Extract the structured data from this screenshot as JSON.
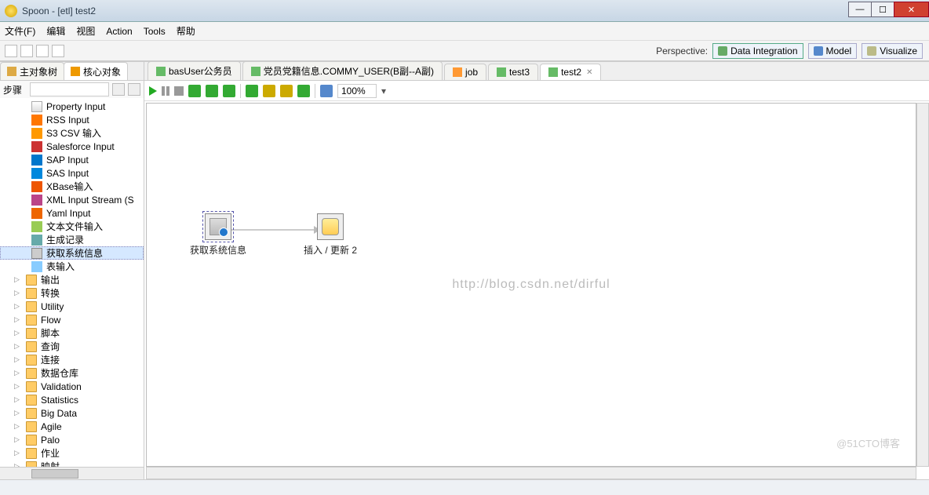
{
  "window": {
    "title": "Spoon - [etl] test2"
  },
  "menu": {
    "file": "文件(F)",
    "edit": "编辑",
    "view": "视图",
    "action": "Action",
    "tools": "Tools",
    "help": "帮助"
  },
  "perspective": {
    "label": "Perspective:",
    "data_integration": "Data Integration",
    "model": "Model",
    "visualize": "Visualize"
  },
  "left": {
    "tab_main": "主对象树",
    "tab_core": "核心对象",
    "steps_label": "步骤",
    "tree_leaf": [
      {
        "label": "Property Input",
        "cls": "file"
      },
      {
        "label": "RSS Input",
        "cls": "rss"
      },
      {
        "label": "S3 CSV 输入",
        "cls": "s3"
      },
      {
        "label": "Salesforce Input",
        "cls": "sf"
      },
      {
        "label": "SAP Input",
        "cls": "sap"
      },
      {
        "label": "SAS Input",
        "cls": "sas"
      },
      {
        "label": "XBase输入",
        "cls": "xb"
      },
      {
        "label": "XML Input Stream (S",
        "cls": "xml"
      },
      {
        "label": "Yaml Input",
        "cls": "yaml"
      },
      {
        "label": "文本文件输入",
        "cls": "txt"
      },
      {
        "label": "生成记录",
        "cls": "gen"
      },
      {
        "label": "获取系统信息",
        "cls": "sys",
        "selected": true
      },
      {
        "label": "表输入",
        "cls": "tbl"
      }
    ],
    "tree_folders": [
      "输出",
      "转换",
      "Utility",
      "Flow",
      "脚本",
      "查询",
      "连接",
      "数据仓库",
      "Validation",
      "Statistics",
      "Big Data",
      "Agile",
      "Palo",
      "作业",
      "映射"
    ]
  },
  "editor": {
    "tabs": [
      {
        "label": "basUser公务员",
        "type": "trans"
      },
      {
        "label": "党员党籍信息.COMMY_USER(B副--A副)",
        "type": "trans"
      },
      {
        "label": "job",
        "type": "job"
      },
      {
        "label": "test3",
        "type": "trans"
      },
      {
        "label": "test2",
        "type": "trans",
        "active": true
      }
    ],
    "zoom": "100%",
    "nodes": {
      "n1": "获取系统信息",
      "n2": "插入 / 更新 2"
    },
    "watermark": "http://blog.csdn.net/dirful",
    "corner": "@51CTO博客"
  }
}
